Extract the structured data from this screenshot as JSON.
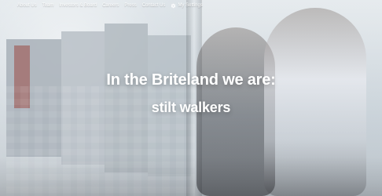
{
  "nav": {
    "items": [
      {
        "label": "About Us"
      },
      {
        "label": "Team"
      },
      {
        "label": "Investors & Board"
      },
      {
        "label": "Careers"
      },
      {
        "label": "Press"
      },
      {
        "label": "Contact Us"
      }
    ],
    "settings_label": "My Settings",
    "settings_icon": "gear-icon"
  },
  "hero": {
    "title_line1": "In the Briteland we are:",
    "title_line2": "stilt walkers"
  },
  "colors": {
    "text": "#ffffff"
  }
}
